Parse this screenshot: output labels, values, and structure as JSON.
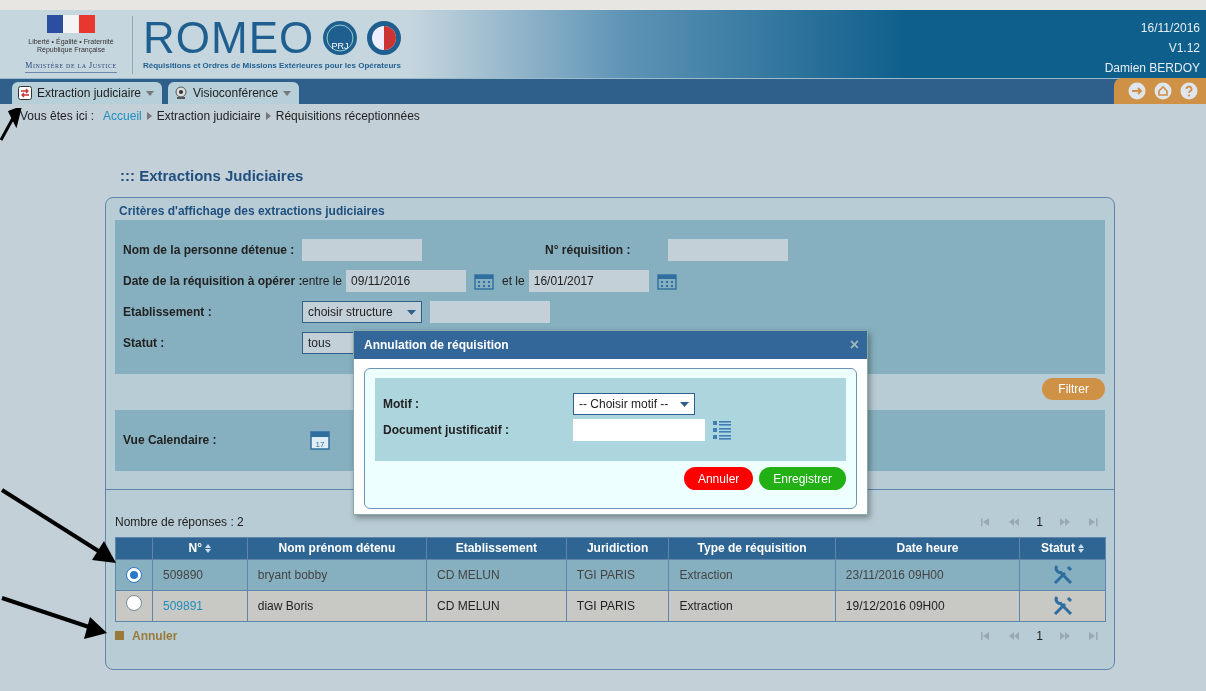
{
  "header": {
    "motto": "Liberté • Égalité • Fraternité",
    "republic": "République Française",
    "ministry": "Ministère de la Justice",
    "app_name": "ROMEO",
    "badge_text": "PRJ",
    "subtitle": "Réquisitions et Ordres de Missions Extérieures pour les Opérateurs",
    "date": "16/11/2016",
    "version": "V1.12",
    "user": "Damien BERDOY"
  },
  "nav_tabs": [
    {
      "label": "Extraction judiciaire",
      "kind": "extraction",
      "selected": false
    },
    {
      "label": "Visioconférence",
      "kind": "visio",
      "selected": false
    }
  ],
  "breadcrumb": {
    "prefix": "Vous êtes ici :",
    "items": [
      {
        "label": "Accueil",
        "link": true
      },
      {
        "label": "Extraction judiciaire",
        "link": false
      },
      {
        "label": "Réquisitions réceptionnées",
        "link": false
      }
    ]
  },
  "page_title": "::: Extractions Judiciaires",
  "criteria": {
    "title": "Critères d'affichage des extractions judiciaires",
    "detainee_label": "Nom de la personne détenue :",
    "requisition_label": "N° réquisition :",
    "date_label": "Date de la réquisition à opérer :",
    "from_label": "entre le",
    "from_value": "09/11/2016",
    "to_label": "et le",
    "to_value": "16/01/2017",
    "establishment_label": "Etablissement :",
    "establishment_value": "choisir structure",
    "status_label": "Statut :",
    "status_value": "tous",
    "filter_button": "Filtrer",
    "calendar_label": "Vue Calendaire :",
    "calendar_day": "17"
  },
  "results": {
    "count": "Nombre de réponses : 2",
    "page": "1",
    "columns": [
      {
        "label": "N°",
        "sortable": true
      },
      {
        "label": "Nom prénom détenu",
        "sortable": false
      },
      {
        "label": "Etablissement",
        "sortable": false
      },
      {
        "label": "Juridiction",
        "sortable": false
      },
      {
        "label": "Type de réquisition",
        "sortable": false
      },
      {
        "label": "Date heure",
        "sortable": false
      },
      {
        "label": "Statut",
        "sortable": true
      }
    ],
    "rows": [
      {
        "selected": true,
        "number": "509890",
        "number_link": false,
        "name": "bryant bobby",
        "establishment": "CD MELUN",
        "jurisdiction": "TGI PARIS",
        "type": "Extraction",
        "date": "23/11/2016 09H00"
      },
      {
        "selected": false,
        "number": "509891",
        "number_link": true,
        "name": "diaw Boris",
        "establishment": "CD MELUN",
        "jurisdiction": "TGI PARIS",
        "type": "Extraction",
        "date": "19/12/2016 09H00"
      }
    ],
    "bottom_page": "1",
    "action": "Annuler"
  },
  "modal": {
    "title": "Annulation de réquisition",
    "close": "×",
    "motif_label": "Motif :",
    "motif_value": "-- Choisir motif --",
    "document_label": "Document justificatif :",
    "cancel_button": "Annuler",
    "save_button": "Enregistrer"
  }
}
